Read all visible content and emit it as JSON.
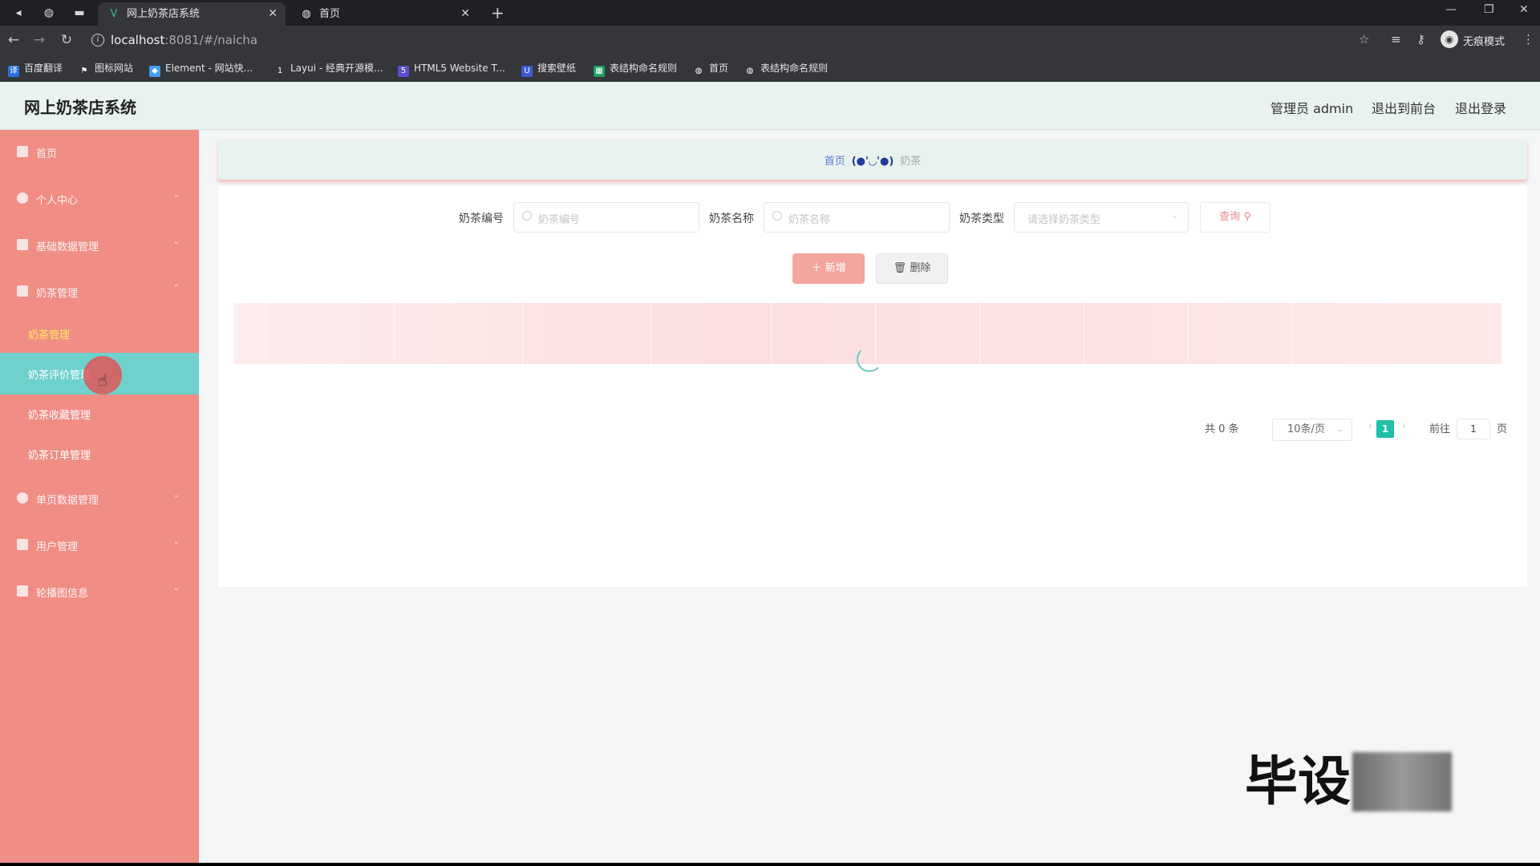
{
  "browser": {
    "tabs": [
      {
        "title": "网上奶茶店系统",
        "icon": "vue-logo-icon",
        "active": true
      },
      {
        "title": "首页",
        "icon": "globe-icon",
        "active": false
      }
    ],
    "url_host": "localhost",
    "url_path": ":8081/#/naicha",
    "incognito_label": "无痕模式",
    "bookmarks": [
      {
        "label": "百度翻译",
        "icon": "translate-icon",
        "color": "#2b6fe0"
      },
      {
        "label": "图标网站",
        "icon": "flag-icon",
        "color": "#555555"
      },
      {
        "label": "Element - 网站快...",
        "icon": "element-icon",
        "color": "#409eff"
      },
      {
        "label": "Layui - 经典开源模...",
        "icon": "layui-icon",
        "color": "#555555"
      },
      {
        "label": "HTML5 Website T...",
        "icon": "html5-icon",
        "color": "#5a4fd6"
      },
      {
        "label": "搜索壁纸",
        "icon": "wallpaper-icon",
        "color": "#3b5bd6"
      },
      {
        "label": "表结构命名规则",
        "icon": "sheet-icon",
        "color": "#1aa260"
      },
      {
        "label": "首页",
        "icon": "globe-icon",
        "color": "#555555"
      },
      {
        "label": "表结构命名规则",
        "icon": "globe-icon",
        "color": "#555555"
      }
    ]
  },
  "app": {
    "title": "网上奶茶店系统",
    "header_links": {
      "admin": "管理员 admin",
      "front": "退出到前台",
      "logout": "退出登录"
    },
    "sidebar": {
      "items": [
        {
          "label": "首页",
          "has_arrow": false
        },
        {
          "label": "个人中心",
          "has_arrow": true
        },
        {
          "label": "基础数据管理",
          "has_arrow": true
        },
        {
          "label": "奶茶管理",
          "has_arrow": true,
          "expanded": true
        },
        {
          "label": "单页数据管理",
          "has_arrow": true
        },
        {
          "label": "用户管理",
          "has_arrow": true
        },
        {
          "label": "轮播图信息",
          "has_arrow": true
        }
      ],
      "sub_items": [
        {
          "label": "奶茶管理",
          "current": true
        },
        {
          "label": "奶茶评价管理",
          "hover": true
        },
        {
          "label": "奶茶收藏管理"
        },
        {
          "label": "奶茶订单管理"
        }
      ]
    },
    "breadcrumb": {
      "home": "首页",
      "separator": "(●'◡'●)",
      "current": "奶茶"
    },
    "filters": {
      "code_label": "奶茶编号",
      "code_placeholder": "奶茶编号",
      "name_label": "奶茶名称",
      "name_placeholder": "奶茶名称",
      "type_label": "奶茶类型",
      "type_placeholder": "请选择奶茶类型",
      "query_button": "查询"
    },
    "actions": {
      "add": "新增",
      "delete": "删除"
    },
    "pagination": {
      "total": "共 0 条",
      "page_size": "10条/页",
      "current_page": "1",
      "goto_prefix": "前往",
      "goto_value": "1",
      "goto_suffix": "页"
    },
    "colors": {
      "sidebar": "#f08d85",
      "sidebar_hover": "#6ed1cc",
      "header": "#e9f2ee",
      "accent_teal": "#20c0a8"
    }
  },
  "watermark": {
    "text": "毕设"
  }
}
